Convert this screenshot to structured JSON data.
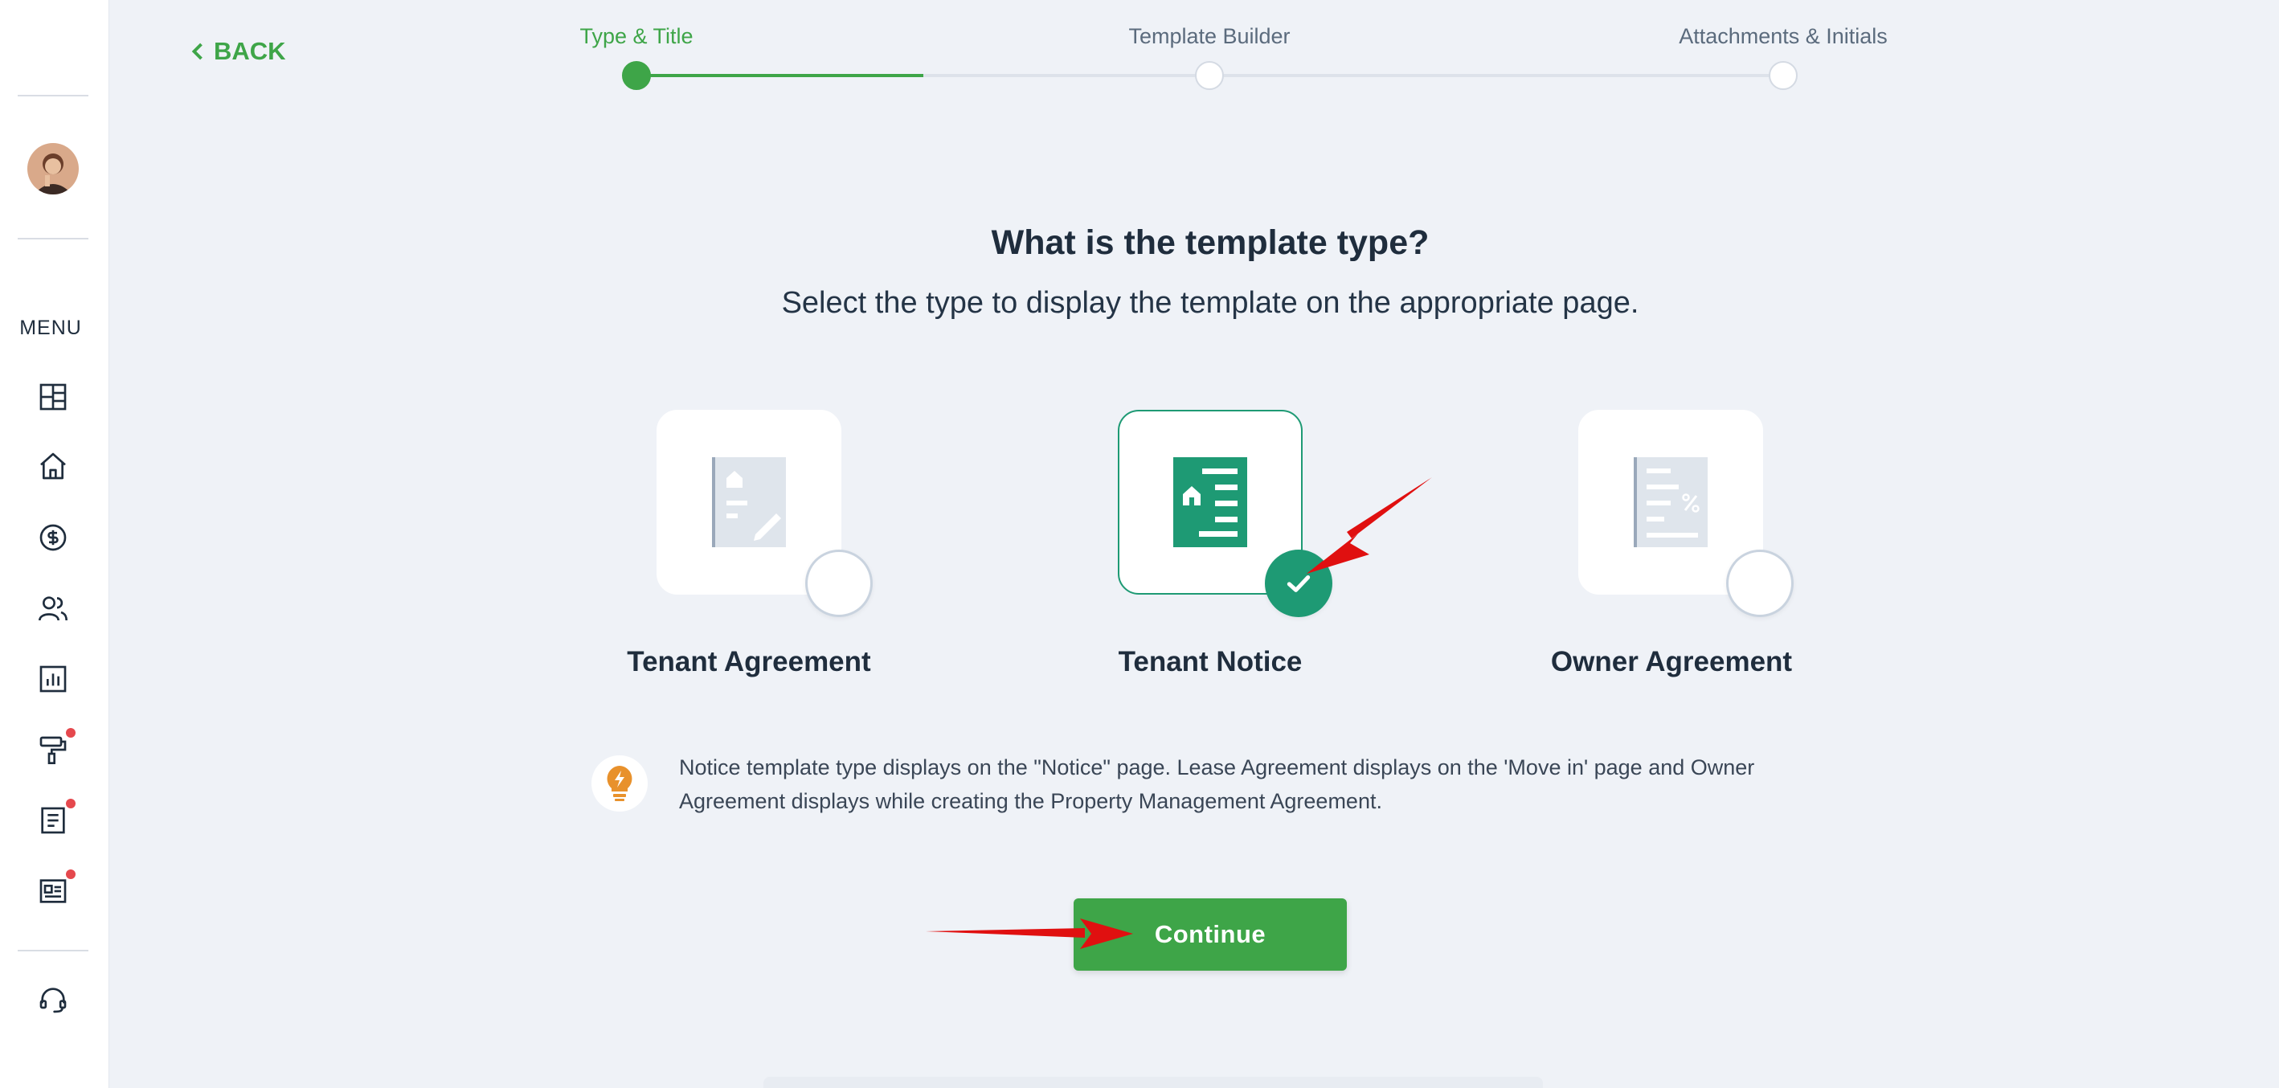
{
  "back": {
    "label": "BACK"
  },
  "stepper": {
    "steps": [
      {
        "label": "Type & Title",
        "state": "active"
      },
      {
        "label": "Template Builder",
        "state": "pending"
      },
      {
        "label": "Attachments & Initials",
        "state": "pending"
      }
    ],
    "progress": 0.5
  },
  "sidebar": {
    "menu_label": "MENU",
    "items": [
      {
        "icon": "dashboard-icon",
        "badge": false
      },
      {
        "icon": "home-icon",
        "badge": false
      },
      {
        "icon": "dollar-icon",
        "badge": false
      },
      {
        "icon": "users-icon",
        "badge": false
      },
      {
        "icon": "reports-icon",
        "badge": false
      },
      {
        "icon": "maintenance-icon",
        "badge": true
      },
      {
        "icon": "document-icon",
        "badge": true
      },
      {
        "icon": "news-icon",
        "badge": true
      }
    ],
    "support_icon": "headset-icon"
  },
  "main": {
    "heading": "What is the template type?",
    "subheading": "Select the type to display the template on the appropriate page.",
    "options": [
      {
        "label": "Tenant Agreement",
        "icon": "agreement-doc-icon",
        "selected": false
      },
      {
        "label": "Tenant Notice",
        "icon": "notice-doc-icon",
        "selected": true
      },
      {
        "label": "Owner Agreement",
        "icon": "owner-doc-icon",
        "selected": false
      }
    ],
    "note": "Notice template type displays on the \"Notice\" page. Lease Agreement displays on the 'Move in' page and Owner Agreement displays while creating the Property Management Agreement.",
    "continue_label": "Continue"
  },
  "colors": {
    "accent_green": "#3ea548",
    "selected_teal": "#1e9a74",
    "annotation_red": "#e01010",
    "badge_red": "#e5484d",
    "bulb_orange": "#e8912c"
  }
}
